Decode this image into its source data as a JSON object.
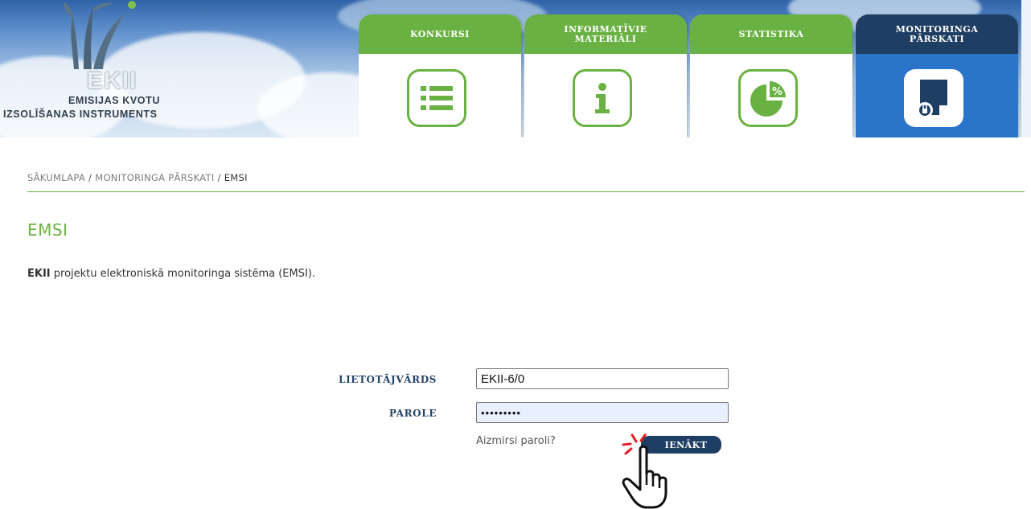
{
  "logo": {
    "name": "EKII",
    "line1": "EMISIJAS KVOTU",
    "line2": "IZSOLĪŠANAS INSTRUMENTS"
  },
  "nav": [
    {
      "label": "KONKURSI",
      "icon": "list-icon",
      "active": false
    },
    {
      "label_line1": "INFORMATĪVIE",
      "label_line2": "MATERIĀLI",
      "icon": "info-icon",
      "active": false
    },
    {
      "label": "STATISTIKA",
      "icon": "pie-chart-percent-icon",
      "active": false
    },
    {
      "label_line1": "MONITORINGA",
      "label_line2": "PĀRSKATI",
      "icon": "document-lock-icon",
      "active": true
    }
  ],
  "breadcrumb": {
    "home": "SĀKUMLAPA",
    "section": "MONITORINGA PĀRSKATI",
    "current": "EMSI",
    "separator": "/"
  },
  "page": {
    "title": "EMSI",
    "intro_bold": "EKII",
    "intro_rest": " projektu elektroniskā monitoringa sistēma (EMSI)."
  },
  "login": {
    "username_label": "LIETOTĀJVĀRDS",
    "username_value": "EKII-6/0",
    "password_label": "PAROLE",
    "password_value": "•••••••••",
    "forgot_link": "Aizmirsi paroli?",
    "submit_label": "IENĀKT"
  },
  "colors": {
    "accent_green": "#6ab143",
    "navy": "#1f3e63",
    "active_blue": "#2a74c9"
  }
}
